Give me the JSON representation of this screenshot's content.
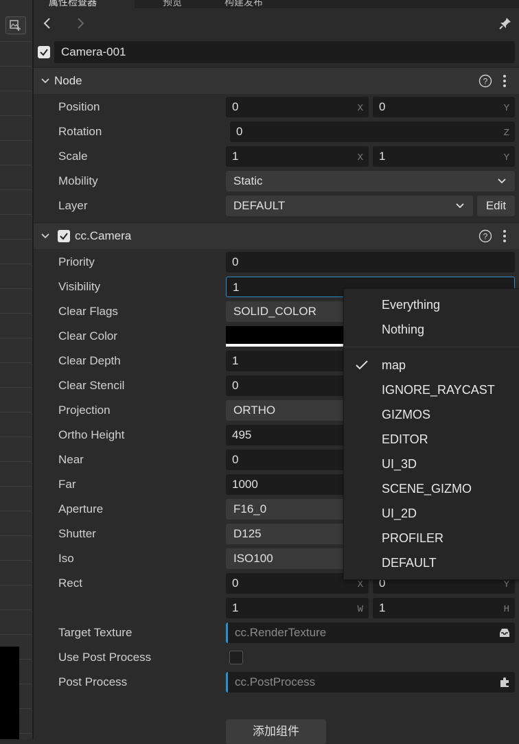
{
  "tabs": {
    "tab1": "属性检查器",
    "tab2": "预览",
    "tab3": "构建发布"
  },
  "node_name": "Camera-001",
  "node_section": {
    "title": "Node",
    "position": {
      "label": "Position",
      "x": "0",
      "y": "0",
      "x_axis": "X",
      "y_axis": "Y"
    },
    "rotation": {
      "label": "Rotation",
      "z": "0",
      "z_axis": "Z"
    },
    "scale": {
      "label": "Scale",
      "x": "1",
      "y": "1",
      "x_axis": "X",
      "y_axis": "Y"
    },
    "mobility": {
      "label": "Mobility",
      "value": "Static"
    },
    "layer": {
      "label": "Layer",
      "value": "DEFAULT",
      "edit": "Edit"
    }
  },
  "camera_section": {
    "title": "cc.Camera",
    "priority": {
      "label": "Priority",
      "value": "0"
    },
    "visibility": {
      "label": "Visibility",
      "value": "1"
    },
    "clear_flags": {
      "label": "Clear Flags",
      "value": "SOLID_COLOR"
    },
    "clear_color": {
      "label": "Clear Color",
      "color": "#000000"
    },
    "clear_depth": {
      "label": "Clear Depth",
      "value": "1"
    },
    "clear_stencil": {
      "label": "Clear Stencil",
      "value": "0"
    },
    "projection": {
      "label": "Projection",
      "value": "ORTHO"
    },
    "ortho_height": {
      "label": "Ortho Height",
      "value": "495"
    },
    "near": {
      "label": "Near",
      "value": "0"
    },
    "far": {
      "label": "Far",
      "value": "1000"
    },
    "aperture": {
      "label": "Aperture",
      "value": "F16_0"
    },
    "shutter": {
      "label": "Shutter",
      "value": "D125"
    },
    "iso": {
      "label": "Iso",
      "value": "ISO100"
    },
    "rect": {
      "label": "Rect",
      "x": "0",
      "y": "0",
      "w": "1",
      "h": "1",
      "x_axis": "X",
      "y_axis": "Y",
      "w_axis": "W",
      "h_axis": "H"
    },
    "target_texture": {
      "label": "Target Texture",
      "placeholder": "cc.RenderTexture"
    },
    "use_post_process": {
      "label": "Use Post Process"
    },
    "post_process": {
      "label": "Post Process",
      "placeholder": "cc.PostProcess"
    }
  },
  "visibility_menu": {
    "everything": "Everything",
    "nothing": "Nothing",
    "layers": [
      "map",
      "IGNORE_RAYCAST",
      "GIZMOS",
      "EDITOR",
      "UI_3D",
      "SCENE_GIZMO",
      "UI_2D",
      "PROFILER",
      "DEFAULT"
    ]
  },
  "add_component": "添加组件",
  "colors": {
    "accent": "#2d8fd0",
    "panel": "#2b2b2b",
    "field": "#1c1c1c"
  }
}
